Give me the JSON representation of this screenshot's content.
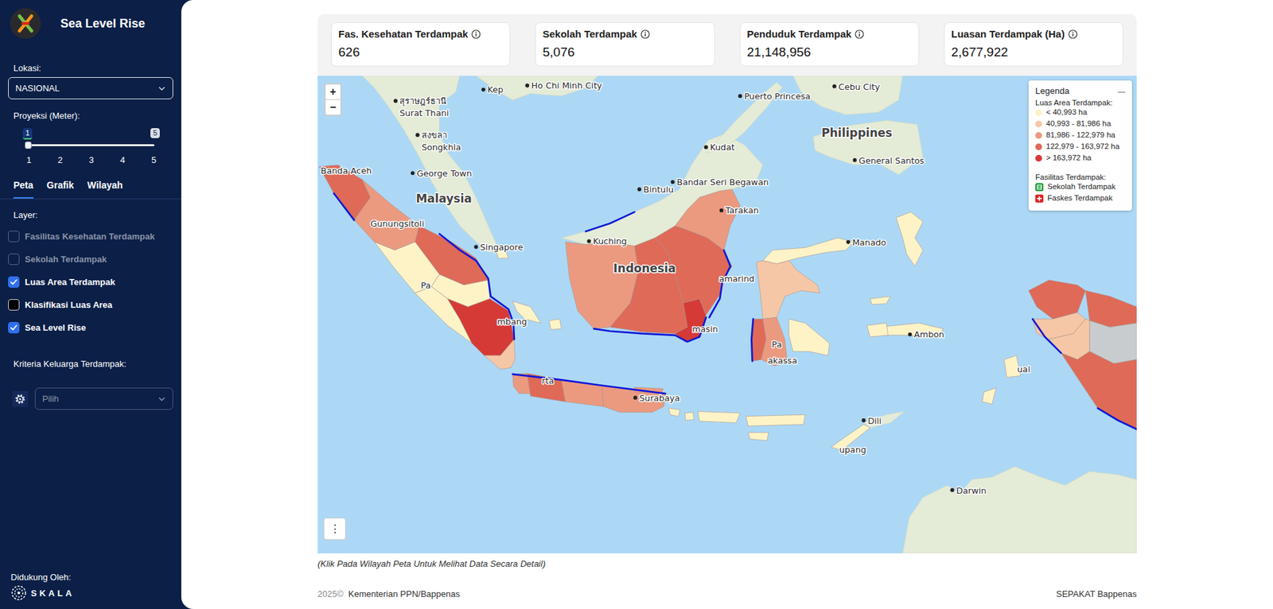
{
  "sidebar": {
    "title": "Sea Level Rise",
    "location": {
      "label": "Lokasi:",
      "value": "NASIONAL"
    },
    "projection": {
      "label": "Proyeksi (Meter):",
      "value": "1",
      "max": "5",
      "ticks": [
        "1",
        "2",
        "3",
        "4",
        "5"
      ],
      "level": 0
    },
    "tabs": [
      {
        "label": "Peta",
        "selected": true
      },
      {
        "label": "Grafik",
        "selected": false
      },
      {
        "label": "Wilayah",
        "selected": false
      }
    ],
    "layers_label": "Layer:",
    "layers": [
      {
        "label": "Fasilitas Kesehatan Terdampak",
        "checked": false,
        "disabled": true
      },
      {
        "label": "Sekolah Terdampak",
        "checked": false,
        "disabled": true
      },
      {
        "label": "Luas Area Terdampak",
        "checked": true,
        "disabled": false
      },
      {
        "label": "Klasifikasi Luas Area",
        "checked": false,
        "disabled": false
      },
      {
        "label": "Sea Level Rise",
        "checked": true,
        "disabled": false
      }
    ],
    "criteria": {
      "label": "Kriteria Keluarga Terdampak:",
      "placeholder": "Pilih"
    },
    "supported_by": "Didukung Oleh:",
    "sponsor": "SKALA"
  },
  "stats": [
    {
      "label": "Fas. Kesehatan Terdampak",
      "value": "626"
    },
    {
      "label": "Sekolah Terdampak",
      "value": "5,076"
    },
    {
      "label": "Penduduk Terdampak",
      "value": "21,148,956"
    },
    {
      "label": "Luasan Terdampak (Ha)",
      "value": "2,677,922"
    }
  ],
  "map": {
    "zoom_in": "+",
    "zoom_out": "−",
    "menu": "⋮",
    "legend": {
      "title": "Legenda",
      "collapse": "—",
      "area_title": "Luas Area Terdampak:",
      "classes": [
        {
          "label": "< 40,993 ha",
          "color": "#fdf3c7"
        },
        {
          "label": "40,993 - 81,986 ha",
          "color": "#f6c7a6"
        },
        {
          "label": "81,986 - 122,979 ha",
          "color": "#eb9a80"
        },
        {
          "label": "122,979 - 163,972 ha",
          "color": "#df6a58"
        },
        {
          "label": "> 163,972 ha",
          "color": "#d63a36"
        }
      ],
      "facilities_title": "Fasilitas Terdampak:",
      "facilities": [
        {
          "label": "Sekolah Terdampak",
          "color": "#1f9d3a"
        },
        {
          "label": "Faskes Terdampak",
          "color": "#e02424"
        }
      ]
    },
    "regions": [
      {
        "color": "#df6a58"
      },
      {
        "color": "#eb9a80"
      },
      {
        "color": "#df6a58"
      },
      {
        "color": "#fdf3c7"
      },
      {
        "color": "#fdf3c7"
      },
      {
        "color": "#fdf3c7"
      },
      {
        "color": "#d63a36"
      },
      {
        "color": "#f6c7a6"
      },
      {
        "color": "#fdf3c7"
      },
      {
        "color": "#fdf3c7"
      },
      {
        "color": "#eb9a80"
      },
      {
        "color": "#df6a58"
      },
      {
        "color": "#eb9a80"
      },
      {
        "color": "#eb9a80"
      },
      {
        "color": "#fdf3c7"
      },
      {
        "color": "#fdf3c7"
      },
      {
        "color": "#fdf3c7"
      },
      {
        "color": "#eb9a80"
      },
      {
        "color": "#df6a58"
      },
      {
        "color": "#d63a36"
      },
      {
        "color": "#df6a58"
      },
      {
        "color": "#eb9a80"
      },
      {
        "color": "#fdf3c7"
      },
      {
        "color": "#f6c7a6"
      },
      {
        "color": "#df6a58"
      },
      {
        "color": "#eb9a80"
      },
      {
        "color": "#fdf3c7"
      },
      {
        "color": "#fdf3c7"
      },
      {
        "color": "#fdf3c7"
      },
      {
        "color": "#df6a58"
      },
      {
        "color": "#f6c7a6"
      },
      {
        "color": "#df6a58"
      },
      {
        "color": "#c9cccf"
      },
      {
        "color": "#f6c7a6"
      },
      {
        "color": "#df6a58"
      }
    ],
    "places": [
      {
        "label": "Kep",
        "kind": "city"
      },
      {
        "label": "Ho Chi Minh City",
        "kind": "city"
      },
      {
        "label": "Puerto Princesa",
        "kind": "city"
      },
      {
        "label": "Cebu City",
        "kind": "city"
      },
      {
        "label": "สุราษฎร์ธานี",
        "kind": "city"
      },
      {
        "label": "Surat Thani",
        "kind": "place"
      },
      {
        "label": "สงขลา",
        "kind": "city"
      },
      {
        "label": "Songkhla",
        "kind": "place"
      },
      {
        "label": "Kudat",
        "kind": "city"
      },
      {
        "label": "Philippines",
        "kind": "country"
      },
      {
        "label": "Banda Aceh",
        "kind": "place"
      },
      {
        "label": "George Town",
        "kind": "city"
      },
      {
        "label": "Bandar Seri Begawan",
        "kind": "city"
      },
      {
        "label": "General Santos",
        "kind": "city"
      },
      {
        "label": "Malaysia",
        "kind": "country"
      },
      {
        "label": "Bintulu",
        "kind": "city"
      },
      {
        "label": "Tarakan",
        "kind": "city"
      },
      {
        "label": "Manado",
        "kind": "city"
      },
      {
        "label": "Singapore",
        "kind": "city"
      },
      {
        "label": "Kuching",
        "kind": "city"
      },
      {
        "label": "Gunungsitoli",
        "kind": "place"
      },
      {
        "label": "Indonesia",
        "kind": "country"
      },
      {
        "label": "amarind",
        "kind": "place"
      },
      {
        "label": "mbang",
        "kind": "place"
      },
      {
        "label": "masin",
        "kind": "place"
      },
      {
        "label": "Ambon",
        "kind": "city"
      },
      {
        "label": "akassa",
        "kind": "place"
      },
      {
        "label": "Surabaya",
        "kind": "city"
      },
      {
        "label": "rta",
        "kind": "place"
      },
      {
        "label": "Dili",
        "kind": "city"
      },
      {
        "label": "upang",
        "kind": "place"
      },
      {
        "label": "Darwin",
        "kind": "city"
      },
      {
        "label": "ual",
        "kind": "place"
      },
      {
        "label": "Pa",
        "kind": "place"
      },
      {
        "label": "Pa",
        "kind": "place"
      }
    ]
  },
  "caption": "(Klik Pada Wilayah Peta Untuk Melihat Data Secara Detail)",
  "footer": {
    "year": "2025©",
    "org": "Kementerian PPN/Bappenas",
    "right": "SEPAKAT Bappenas"
  }
}
